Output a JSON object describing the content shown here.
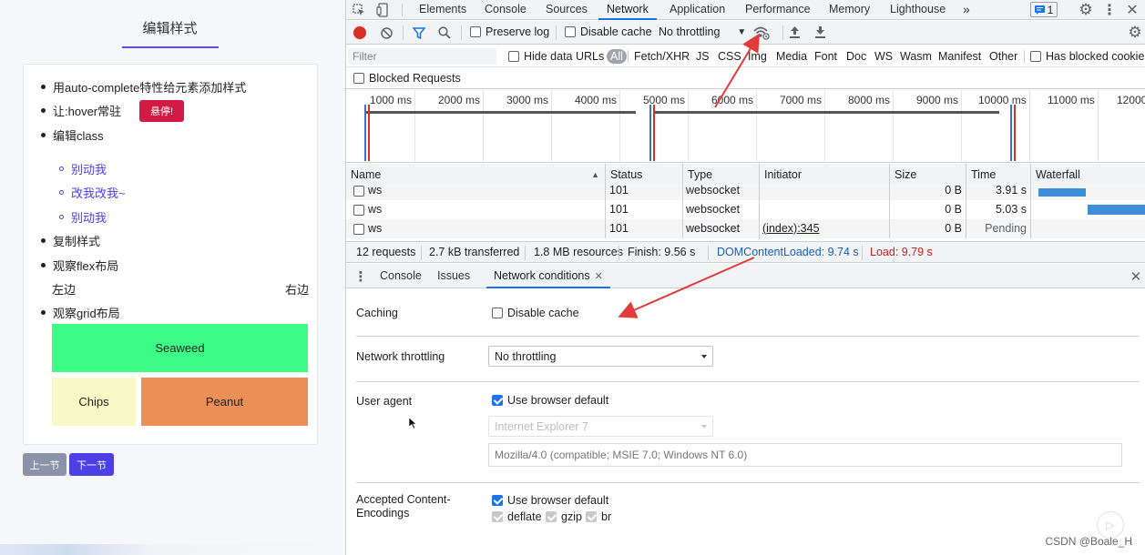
{
  "left": {
    "title": "编辑样式",
    "items": [
      "用auto-complete特性给元素添加样式",
      "让:hover常驻",
      "编辑class",
      "复制样式",
      "观察flex布局",
      "观察grid布局"
    ],
    "hover_button": "悬停!",
    "sub_items": [
      "别动我",
      "改我改我~",
      "别动我"
    ],
    "flex_left": "左边",
    "flex_right": "右边",
    "grid": {
      "seaweed": "Seaweed",
      "chips": "Chips",
      "peanut": "Peanut",
      "colors": {
        "seaweed": "#3dfc86",
        "chips": "#f8f9c6",
        "peanut": "#ea8f56"
      }
    },
    "prev_button": "上一节",
    "next_button": "下一节"
  },
  "devtools": {
    "main_tabs": [
      "Elements",
      "Console",
      "Sources",
      "Network",
      "Application",
      "Performance",
      "Memory",
      "Lighthouse"
    ],
    "active_tab": "Network",
    "more_tabs": "»",
    "issues_badge": "1",
    "toolbar": {
      "preserve_log": "Preserve log",
      "disable_cache": "Disable cache",
      "throttling": "No throttling"
    },
    "filter": {
      "placeholder": "Filter",
      "hide_data_urls": "Hide data URLs",
      "types": [
        "All",
        "Fetch/XHR",
        "JS",
        "CSS",
        "Img",
        "Media",
        "Font",
        "Doc",
        "WS",
        "Wasm",
        "Manifest",
        "Other"
      ],
      "has_blocked_cookies": "Has blocked cookies",
      "blocked_requests": "Blocked Requests"
    },
    "timeline_ticks": [
      "1000 ms",
      "2000 ms",
      "3000 ms",
      "4000 ms",
      "5000 ms",
      "6000 ms",
      "7000 ms",
      "8000 ms",
      "9000 ms",
      "10000 ms",
      "11000 ms",
      "12000"
    ],
    "table": {
      "columns": [
        "Name",
        "Status",
        "Type",
        "Initiator",
        "Size",
        "Time",
        "Waterfall"
      ],
      "rows": [
        {
          "name": "ws",
          "status": "101",
          "type": "websocket",
          "initiator": "",
          "size": "0 B",
          "time": "3.91 s"
        },
        {
          "name": "ws",
          "status": "101",
          "type": "websocket",
          "initiator": "",
          "size": "0 B",
          "time": "5.03 s"
        },
        {
          "name": "ws",
          "status": "101",
          "type": "websocket",
          "initiator": "(index):345",
          "size": "0 B",
          "time": "Pending"
        }
      ]
    },
    "summary": {
      "requests": "12 requests",
      "transferred": "2.7 kB transferred",
      "resources": "1.8 MB resources",
      "finish": "Finish: 9.56 s",
      "dom_content_loaded": "DOMContentLoaded: 9.74 s",
      "load": "Load: 9.79 s",
      "colors": {
        "dcl": "#1a5fb4",
        "load": "#c5221f"
      }
    },
    "drawer_tabs": [
      "Console",
      "Issues",
      "Network conditions"
    ],
    "drawer_active": "Network conditions",
    "conditions": {
      "caching_label": "Caching",
      "disable_cache": "Disable cache",
      "throttling_label": "Network throttling",
      "throttling_value": "No throttling",
      "user_agent_label": "User agent",
      "use_browser_default": "Use browser default",
      "ua_select": "Internet Explorer 7",
      "ua_string": "Mozilla/4.0 (compatible; MSIE 7.0; Windows NT 6.0)",
      "encodings_label_1": "Accepted Content-",
      "encodings_label_2": "Encodings",
      "encodings_default": "Use browser default",
      "encodings": [
        "deflate",
        "gzip",
        "br"
      ]
    }
  },
  "watermark": "CSDN @Boale_H",
  "accent": "#1a73e8"
}
